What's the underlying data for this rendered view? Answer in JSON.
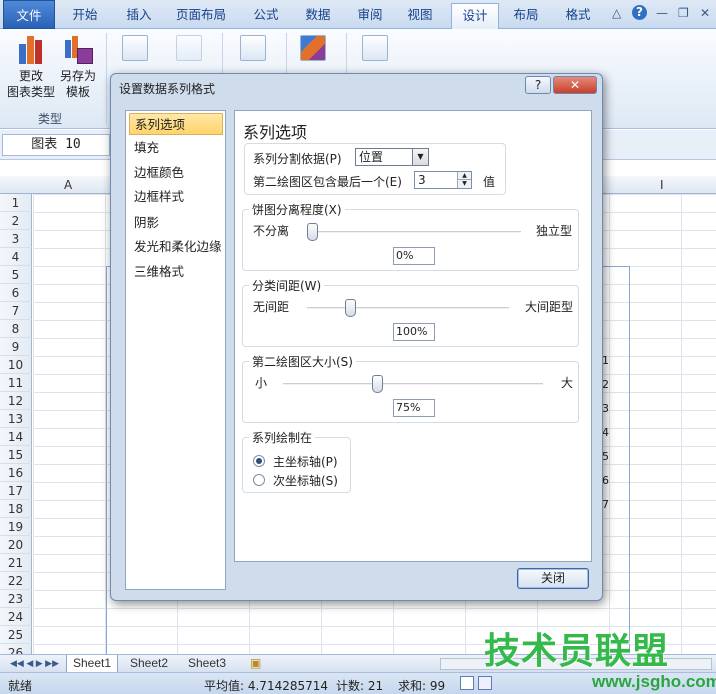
{
  "ribbon_tabs": {
    "file": "文件",
    "home": "开始",
    "insert": "插入",
    "page_layout": "页面布局",
    "formulas": "公式",
    "data": "数据",
    "review": "审阅",
    "view": "视图",
    "design": "设计",
    "layout": "布局",
    "format": "格式"
  },
  "window_controls": {
    "minimize_ribbon": "△",
    "help": "?",
    "minimize": "—",
    "restore": "❐",
    "close": "✕"
  },
  "ribbon": {
    "change_type_l1": "更改",
    "change_type_l2": "图表类型",
    "save_template_l1": "另存为",
    "save_template_l2": "模板",
    "group_type": "类型"
  },
  "formula_bar": {
    "name_box": "图表 10"
  },
  "grid": {
    "col_a": "A",
    "col_i": "I",
    "rows": [
      "1",
      "2",
      "3",
      "4",
      "5",
      "6",
      "7",
      "8",
      "9",
      "10",
      "11",
      "12",
      "13",
      "14",
      "15",
      "16",
      "17",
      "18",
      "19",
      "20",
      "21",
      "22",
      "23",
      "24",
      "25",
      "26"
    ],
    "chart_labels": [
      "1",
      "2",
      "3",
      "4",
      "5",
      "6",
      "7"
    ]
  },
  "sheets": {
    "s1": "Sheet1",
    "s2": "Sheet2",
    "s3": "Sheet3"
  },
  "status": {
    "ready": "就绪",
    "avg": "平均值: 4.714285714",
    "count": "计数: 21",
    "sum": "求和: 99"
  },
  "dialog": {
    "title": "设置数据系列格式",
    "help_btn": "?",
    "close_btn": "✕",
    "nav": [
      "系列选项",
      "填充",
      "边框颜色",
      "边框样式",
      "阴影",
      "发光和柔化边缘",
      "三维格式"
    ],
    "pane_title": "系列选项",
    "split_label": "系列分割依据(P)",
    "split_value": "位置",
    "last_label": "第二绘图区包含最后一个(E)",
    "last_value": "3",
    "last_unit": "值",
    "explosion": {
      "title": "饼图分离程度(X)",
      "min": "不分离",
      "max": "独立型",
      "value": "0%"
    },
    "gap": {
      "title": "分类间距(W)",
      "min": "无间距",
      "max": "大间距型",
      "value": "100%"
    },
    "second_size": {
      "title": "第二绘图区大小(S)",
      "min": "小",
      "max": "大",
      "value": "75%"
    },
    "plot_on": {
      "title": "系列绘制在",
      "primary": "主坐标轴(P)",
      "secondary": "次坐标轴(S)"
    },
    "close_label": "关闭"
  },
  "watermark": {
    "brand": "技术员联盟",
    "url": "www.jsgho.com"
  }
}
